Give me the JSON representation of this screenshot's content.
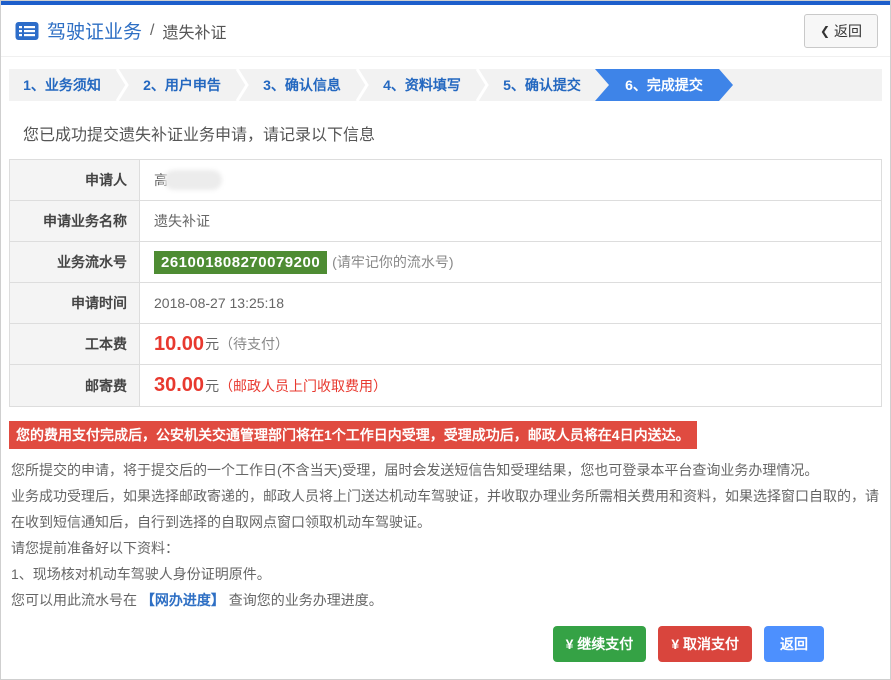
{
  "page": {
    "title": "驾驶证业务",
    "separator": "/",
    "subtitle": "遗失补证"
  },
  "header": {
    "back_chevron": "❮",
    "back_label": "返回"
  },
  "steps": [
    {
      "label": "1、业务须知"
    },
    {
      "label": "2、用户申告"
    },
    {
      "label": "3、确认信息"
    },
    {
      "label": "4、资料填写"
    },
    {
      "label": "5、确认提交"
    },
    {
      "label": "6、完成提交"
    }
  ],
  "success_message": "您已成功提交遗失补证业务申请，请记录以下信息",
  "table": {
    "rows": [
      {
        "label": "申请人",
        "value": "高"
      },
      {
        "label": "申请业务名称",
        "value": "遗失补证"
      },
      {
        "label": "业务流水号",
        "serial": "261001808270079200",
        "serial_note": "(请牢记你的流水号)"
      },
      {
        "label": "申请时间",
        "value": "2018-08-27 13:25:18"
      },
      {
        "label": "工本费",
        "amount": "10.00",
        "unit": "元",
        "note": "（待支付）"
      },
      {
        "label": "邮寄费",
        "amount": "30.00",
        "unit": "元",
        "note": "（邮政人员上门收取费用）"
      }
    ]
  },
  "alert": "您的费用支付完成后，公安机关交通管理部门将在1个工作日内受理，受理成功后，邮政人员将在4日内送达。",
  "notes": {
    "p1": "您所提交的申请，将于提交后的一个工作日(不含当天)受理，届时会发送短信告知受理结果，您也可登录本平台查询业务办理情况。",
    "p2": "业务成功受理后，如果选择邮政寄递的，邮政人员将上门送达机动车驾驶证，并收取办理业务所需相关费用和资料，如果选择窗口自取的，请在收到短信通知后，自行到选择的自取网点窗口领取机动车驾驶证。",
    "p3": "请您提前准备好以下资料：",
    "p4": "1、现场核对机动车驾驶人身份证明原件。",
    "progress_prefix": "您可以用此流水号在",
    "progress_link": "【网办进度】",
    "progress_suffix": "查询您的业务办理进度。"
  },
  "buttons": {
    "continue_pay": "¥ 继续支付",
    "cancel_pay": "¥ 取消支付",
    "back": "返回"
  },
  "colors": {
    "top_bar_blue": "#1d5ecb",
    "title_blue": "#2e6fc4",
    "step_text_blue": "#2468c0",
    "active_step_blue": "#3e84e8",
    "serial_green": "#4e8c33",
    "alert_red": "#e04b40",
    "fee_red": "#e8392f",
    "btn_green": "#35a245",
    "btn_red": "#d9453d",
    "btn_blue": "#4d90fe"
  }
}
